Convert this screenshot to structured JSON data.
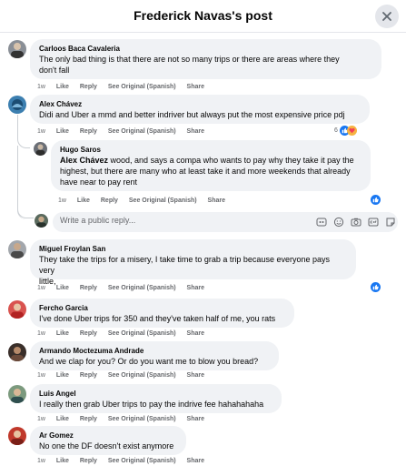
{
  "header": {
    "title": "Frederick Navas's post"
  },
  "common": {
    "time": "1w",
    "like": "Like",
    "reply": "Reply",
    "see_original": "See Original (Spanish)",
    "share": "Share"
  },
  "comments": [
    {
      "author": "Carloos Baca Cavaleria",
      "text": [
        "The only bad thing is that there are not so many trips or there are areas where they",
        "don't fall"
      ]
    },
    {
      "author": "Alex Chávez",
      "text": [
        "Didi and Uber a mmd and better indriver but always put the most expensive price pdj"
      ],
      "reaction_count": "6"
    },
    {
      "author": "Hugo Saros",
      "mention": "Alex Chávez",
      "text": [
        " wood, and says a compa who wants to pay why they take it pay the",
        "highest, but there are many who at least take it and more weekends that already",
        "have near to pay rent"
      ]
    },
    {
      "author": "Miguel Froylan San",
      "text": [
        "They take the trips for a misery, I take time to grab a trip because everyone pays very",
        "little,"
      ]
    },
    {
      "author": "Fercho Garcia",
      "text": [
        "I've done Uber trips for 350 and they've taken half of me, you rats"
      ]
    },
    {
      "author": "Armando Moctezuma Andrade",
      "text": [
        "And we clap for you? Or do you want me to blow you bread?"
      ]
    },
    {
      "author": "Luis Angel",
      "text": [
        "I really then grab Uber trips to pay the indrive fee hahahahaha"
      ]
    },
    {
      "author": "Ar Gomez",
      "text": [
        "No one the DF doesn't exist anymore"
      ]
    }
  ],
  "reply_box": {
    "placeholder": "Write a public reply..."
  },
  "colors": {
    "accent": "#1877f2",
    "bubble": "#f0f2f5",
    "muted": "#65676b",
    "love": "#f33e58"
  }
}
